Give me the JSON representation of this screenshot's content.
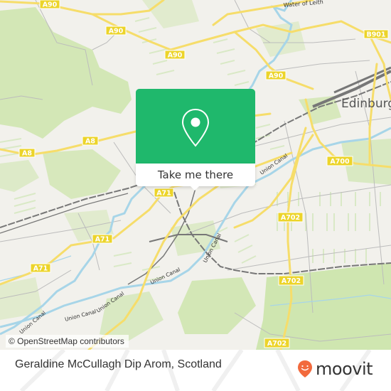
{
  "map": {
    "road_labels": [
      {
        "id": "a90-1",
        "text": "A90"
      },
      {
        "id": "a90-2",
        "text": "A90"
      },
      {
        "id": "a90-3",
        "text": "A90"
      },
      {
        "id": "a90-4",
        "text": "A90"
      },
      {
        "id": "b901",
        "text": "B901"
      },
      {
        "id": "a8-1",
        "text": "A8"
      },
      {
        "id": "a8-2",
        "text": "A8"
      },
      {
        "id": "a700",
        "text": "A700"
      },
      {
        "id": "a71-1",
        "text": "A71"
      },
      {
        "id": "a71-2",
        "text": "A71"
      },
      {
        "id": "a71-3",
        "text": "A71"
      },
      {
        "id": "a702-1",
        "text": "A702"
      },
      {
        "id": "a702-2",
        "text": "A702"
      },
      {
        "id": "a702-3",
        "text": "A702"
      }
    ],
    "water_labels": {
      "river": "Water of Leith",
      "canal_1": "Union Canal",
      "canal_2": "Union Canal",
      "canal_3": "Union Canal",
      "canal_4": "Union Canal",
      "canal_5": "Union Canal",
      "canal_6": "Union Canal"
    },
    "city_label": "Edinburgh",
    "attribution": "© OpenStreetMap contributors",
    "colors": {
      "background": "#f2f1ec",
      "park": "#cfe6b0",
      "road_major": "#f6dd6a",
      "road_label_bg": "#ecd42a",
      "water": "#a7d5e8",
      "rail": "#777777"
    }
  },
  "popup": {
    "button_label": "Take me there",
    "icon": "location-pin-icon",
    "accent_color": "#1fb86c"
  },
  "footer": {
    "place_title": "Geraldine McCullagh Dip Arom, Scotland",
    "brand_name": "moovit",
    "brand_color": "#f26a3d"
  }
}
